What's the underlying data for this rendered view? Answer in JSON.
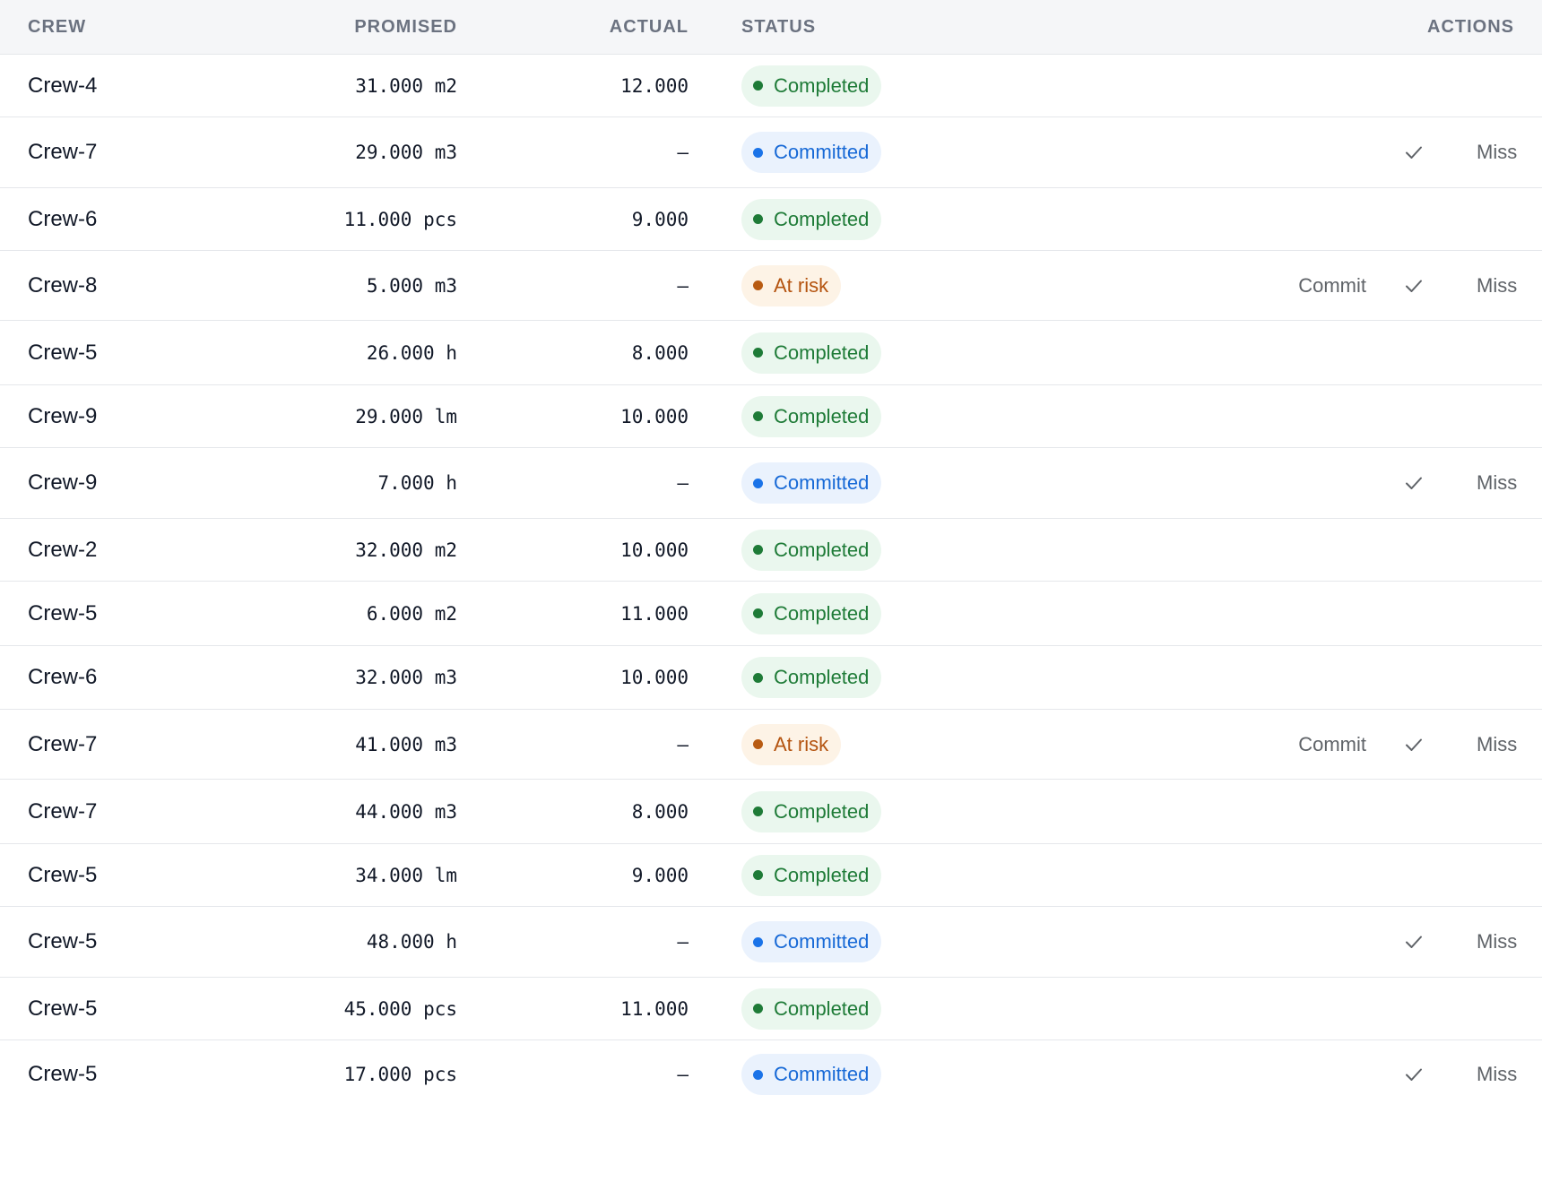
{
  "headers": {
    "crew": "CREW",
    "promised": "PROMISED",
    "actual": "ACTUAL",
    "status": "STATUS",
    "actions": "ACTIONS"
  },
  "action_labels": {
    "commit": "Commit",
    "miss": "Miss",
    "check_icon": "check-icon"
  },
  "status_colors": {
    "completed": "#1e7b37",
    "committed": "#1a73e8",
    "at_risk": "#b85b12"
  },
  "rows": [
    {
      "crew": "Crew-4",
      "promised": "31.000 m2",
      "actual": "12.000",
      "status": "Completed",
      "kind": "completed",
      "actions": []
    },
    {
      "crew": "Crew-7",
      "promised": "29.000 m3",
      "actual": "–",
      "status": "Committed",
      "kind": "committed",
      "actions": [
        "check",
        "miss"
      ]
    },
    {
      "crew": "Crew-6",
      "promised": "11.000 pcs",
      "actual": "9.000",
      "status": "Completed",
      "kind": "completed",
      "actions": []
    },
    {
      "crew": "Crew-8",
      "promised": "5.000 m3",
      "actual": "–",
      "status": "At risk",
      "kind": "atrisk",
      "actions": [
        "commit",
        "check",
        "miss"
      ]
    },
    {
      "crew": "Crew-5",
      "promised": "26.000 h",
      "actual": "8.000",
      "status": "Completed",
      "kind": "completed",
      "actions": []
    },
    {
      "crew": "Crew-9",
      "promised": "29.000 lm",
      "actual": "10.000",
      "status": "Completed",
      "kind": "completed",
      "actions": []
    },
    {
      "crew": "Crew-9",
      "promised": "7.000 h",
      "actual": "–",
      "status": "Committed",
      "kind": "committed",
      "actions": [
        "check",
        "miss"
      ]
    },
    {
      "crew": "Crew-2",
      "promised": "32.000 m2",
      "actual": "10.000",
      "status": "Completed",
      "kind": "completed",
      "actions": []
    },
    {
      "crew": "Crew-5",
      "promised": "6.000 m2",
      "actual": "11.000",
      "status": "Completed",
      "kind": "completed",
      "actions": []
    },
    {
      "crew": "Crew-6",
      "promised": "32.000 m3",
      "actual": "10.000",
      "status": "Completed",
      "kind": "completed",
      "actions": []
    },
    {
      "crew": "Crew-7",
      "promised": "41.000 m3",
      "actual": "–",
      "status": "At risk",
      "kind": "atrisk",
      "actions": [
        "commit",
        "check",
        "miss"
      ]
    },
    {
      "crew": "Crew-7",
      "promised": "44.000 m3",
      "actual": "8.000",
      "status": "Completed",
      "kind": "completed",
      "actions": []
    },
    {
      "crew": "Crew-5",
      "promised": "34.000 lm",
      "actual": "9.000",
      "status": "Completed",
      "kind": "completed",
      "actions": []
    },
    {
      "crew": "Crew-5",
      "promised": "48.000 h",
      "actual": "–",
      "status": "Committed",
      "kind": "committed",
      "actions": [
        "check",
        "miss"
      ]
    },
    {
      "crew": "Crew-5",
      "promised": "45.000 pcs",
      "actual": "11.000",
      "status": "Completed",
      "kind": "completed",
      "actions": []
    },
    {
      "crew": "Crew-5",
      "promised": "17.000 pcs",
      "actual": "–",
      "status": "Committed",
      "kind": "committed",
      "actions": [
        "check",
        "miss"
      ]
    }
  ]
}
